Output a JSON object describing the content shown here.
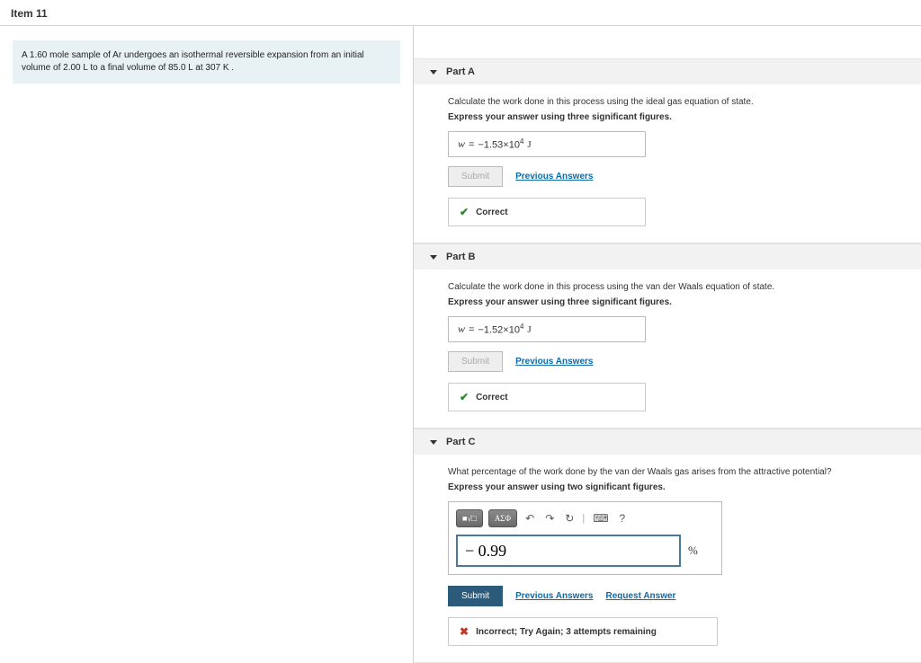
{
  "header": {
    "title": "Item 11"
  },
  "problem": {
    "text": "A 1.60 mole sample of Ar undergoes an isothermal reversible expansion from an initial volume of 2.00 L to a final volume of 85.0 L at 307 K ."
  },
  "parts": {
    "a": {
      "label": "Part A",
      "prompt": "Calculate the work done in this process using the ideal gas equation of state.",
      "instruction": "Express your answer using three significant figures.",
      "answer_var": "w",
      "answer_val_prefix": "−1.53×10",
      "answer_val_sup": "4",
      "answer_unit": "J",
      "submit": "Submit",
      "prev": "Previous Answers",
      "feedback": "Correct"
    },
    "b": {
      "label": "Part B",
      "prompt": "Calculate the work done in this process using the van der Waals equation of state.",
      "instruction": "Express your answer using three significant figures.",
      "answer_var": "w",
      "answer_val_prefix": "−1.52×10",
      "answer_val_sup": "4",
      "answer_unit": "J",
      "submit": "Submit",
      "prev": "Previous Answers",
      "feedback": "Correct"
    },
    "c": {
      "label": "Part C",
      "prompt": "What percentage of the work done by the van der Waals gas arises from the attractive potential?",
      "instruction": "Express your answer using two significant figures.",
      "tool1": "■√□",
      "tool2": "ΑΣΦ",
      "undo": "↶",
      "redo": "↷",
      "reset": "↻",
      "kbd": "⌨",
      "help": "?",
      "value": "− 0.99",
      "unit": "%",
      "submit": "Submit",
      "prev": "Previous Answers",
      "req": "Request Answer",
      "feedback": "Incorrect; Try Again; 3 attempts remaining"
    }
  }
}
